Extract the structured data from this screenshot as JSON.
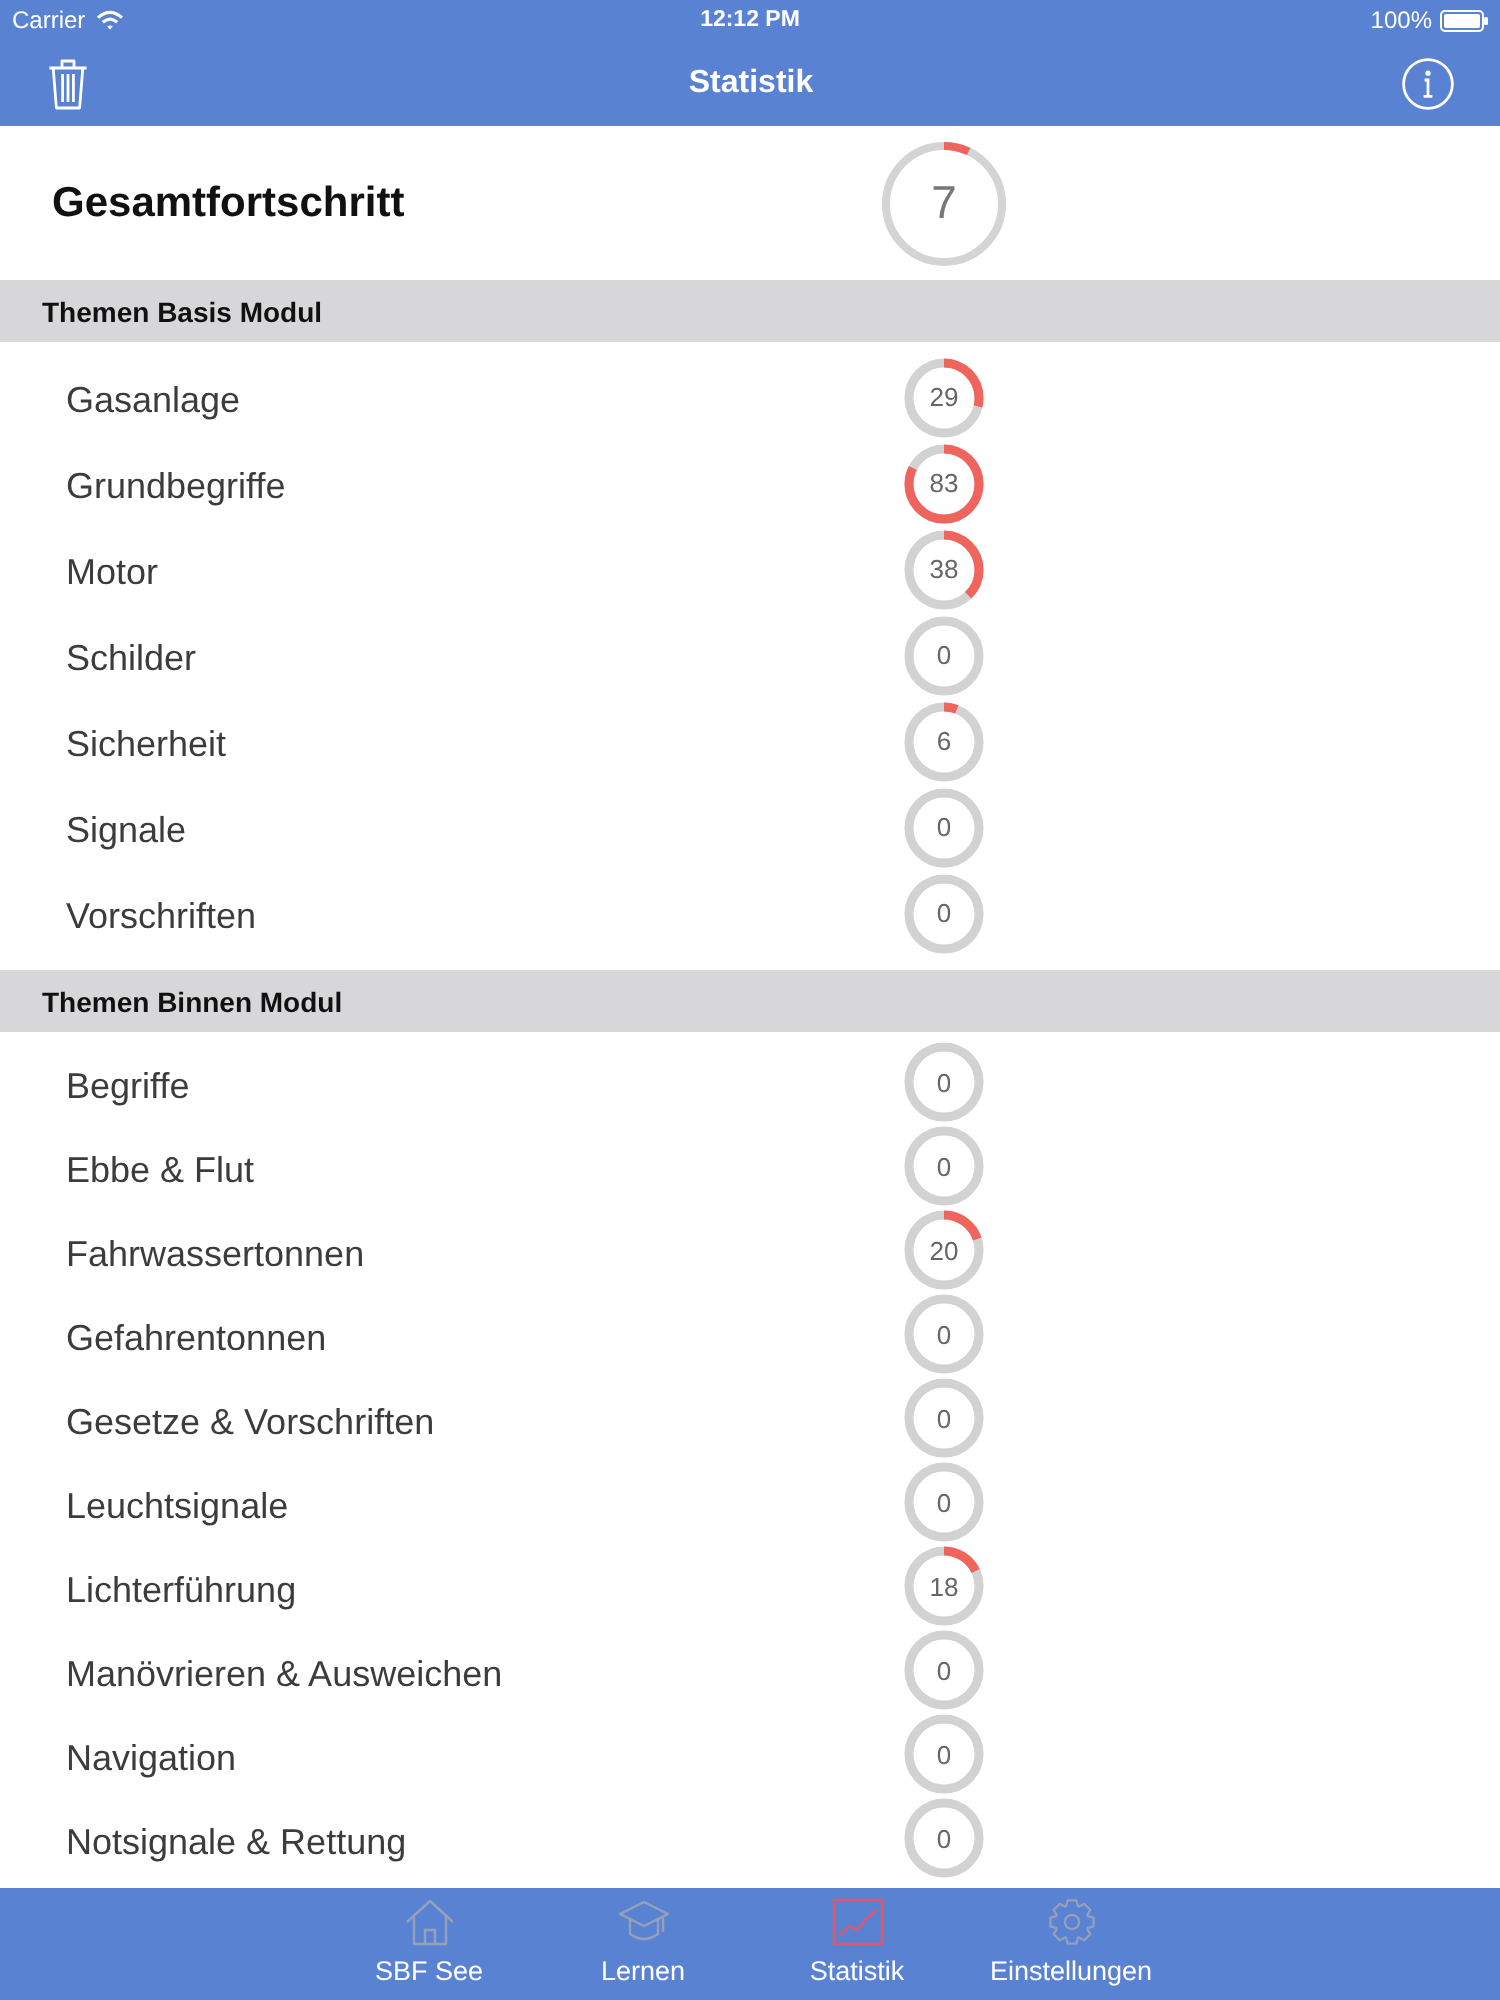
{
  "status_bar": {
    "carrier": "Carrier",
    "time": "12:12 PM",
    "battery": "100%"
  },
  "nav_bar": {
    "title": "Statistik"
  },
  "overall": {
    "label": "Gesamtfortschritt",
    "value": "7",
    "level": 0.07
  },
  "sections": [
    {
      "title": "Themen Basis Modul",
      "topics": [
        {
          "name": "Gasanlage",
          "value": "29",
          "level": 0.29
        },
        {
          "name": "Grundbegriffe",
          "value": "83",
          "level": 0.83
        },
        {
          "name": "Motor",
          "value": "38",
          "level": 0.38
        },
        {
          "name": "Schilder",
          "value": "0",
          "level": 0
        },
        {
          "name": "Sicherheit",
          "value": "6",
          "level": 0.06
        },
        {
          "name": "Signale",
          "value": "0",
          "level": 0
        },
        {
          "name": "Vorschriften",
          "value": "0",
          "level": 0
        }
      ]
    },
    {
      "title": "Themen Binnen Modul",
      "topics": [
        {
          "name": "Begriffe",
          "value": "0",
          "level": 0
        },
        {
          "name": "Ebbe & Flut",
          "value": "0",
          "level": 0
        },
        {
          "name": "Fahrwassertonnen",
          "value": "20",
          "level": 0.2
        },
        {
          "name": "Gefahrentonnen",
          "value": "0",
          "level": 0
        },
        {
          "name": "Gesetze & Vorschriften",
          "value": "0",
          "level": 0
        },
        {
          "name": "Leuchtsignale",
          "value": "0",
          "level": 0
        },
        {
          "name": "Lichterführung",
          "value": "18",
          "level": 0.18
        },
        {
          "name": "Manövrieren & Ausweichen",
          "value": "0",
          "level": 0
        },
        {
          "name": "Navigation",
          "value": "0",
          "level": 0
        },
        {
          "name": "Notsignale & Rettung",
          "value": "0",
          "level": 0
        }
      ]
    }
  ],
  "tab_bar": [
    {
      "label": "SBF See",
      "selected": false
    },
    {
      "label": "Lernen",
      "selected": false
    },
    {
      "label": "Statistik",
      "selected": true
    },
    {
      "label": "Einstellungen",
      "selected": false
    }
  ]
}
